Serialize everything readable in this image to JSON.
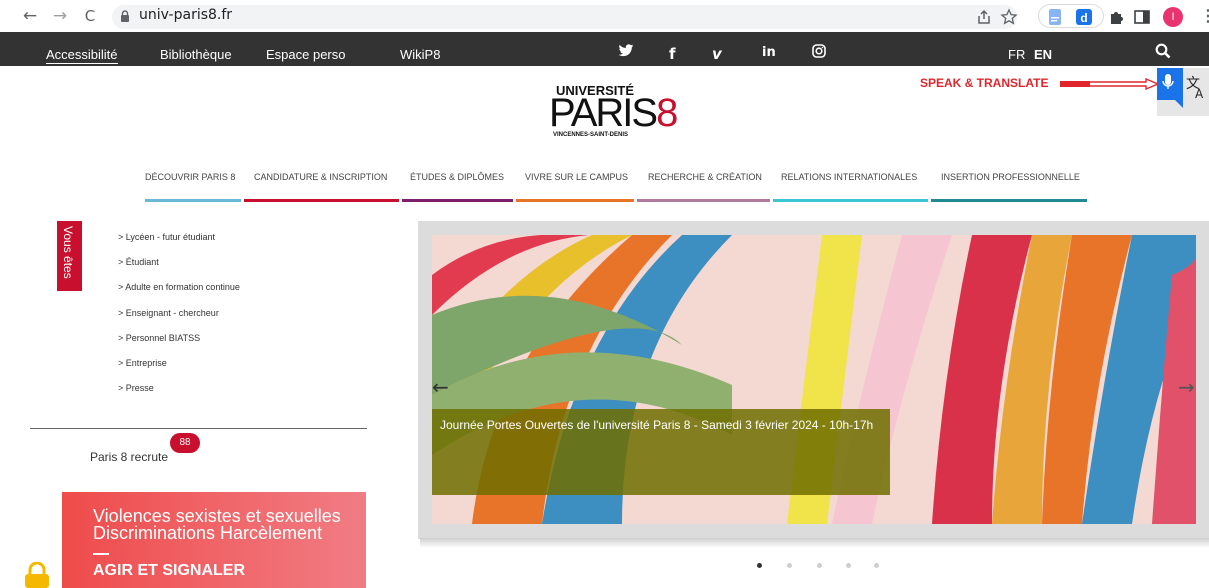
{
  "browser": {
    "url": "univ-paris8.fr",
    "back_icon": "←",
    "forward_icon": "→",
    "reload_icon": "C",
    "profile_initial": "I"
  },
  "topbar": {
    "links": [
      "Accessibilité",
      "Bibliothèque",
      "Espace perso",
      "WikiP8"
    ],
    "social": [
      "twitter-icon",
      "facebook-icon",
      "vimeo-icon",
      "linkedin-icon",
      "instagram-icon"
    ],
    "social_glyphs": [
      "🐦",
      "f",
      "v",
      "in",
      "◎"
    ],
    "lang_fr": "FR",
    "lang_en": "EN"
  },
  "header": {
    "logo_top": "UNIVERSITÉ",
    "logo_main": "PARIS",
    "logo_digit": "8",
    "logo_sub": "VINCENNES-SAINT-DENIS",
    "speak_label": "SPEAK & TRANSLATE"
  },
  "main_menu": [
    {
      "label": "DÉCOUVRIR PARIS 8",
      "color": "#6bb8d6"
    },
    {
      "label": "CANDIDATURE & INSCRIPTION",
      "color": "#c8102e"
    },
    {
      "label": "ÉTUDES & DIPLÔMES",
      "color": "#7d1f6e"
    },
    {
      "label": "VIVRE SUR LE CAMPUS",
      "color": "#e8742a"
    },
    {
      "label": "RECHERCHE & CRÉATION",
      "color": "#b07a9c"
    },
    {
      "label": "RELATIONS INTERNATIONALES",
      "color": "#3cc6d2"
    },
    {
      "label": "INSERTION PROFESSIONNELLE",
      "color": "#1d8a96"
    }
  ],
  "sidebar": {
    "vous_etes": "Vous êtes",
    "items": [
      "> Lycéen - futur étudiant",
      "> Étudiant",
      "> Adulte en formation continue",
      "> Enseignant - chercheur",
      "> Personnel BIATSS",
      "> Entreprise",
      "> Presse"
    ],
    "recrute_label": "Paris 8 recrute",
    "recrute_count": "88",
    "vss_title": "Violences sexistes et sexuelles Discriminations Harcèlement",
    "vss_cta": "AGIR ET SIGNALER"
  },
  "slider": {
    "caption": "Journée Portes Ouvertes de l'université Paris 8 - Samedi 3 février 2024 - 10h-17h",
    "prev": "←",
    "next": "→",
    "dots": 5,
    "active_dot": 0
  },
  "colors": {
    "accent": "#c8102e",
    "topbar": "#333333"
  }
}
